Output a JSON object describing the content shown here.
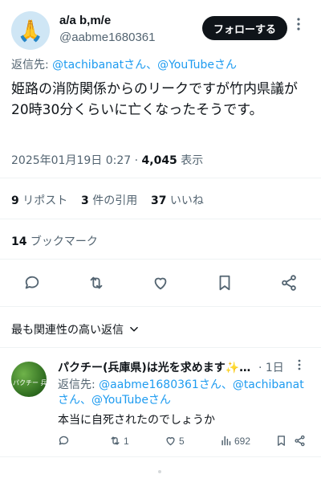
{
  "tweet": {
    "avatar_emoji": "🙏",
    "display_name": "a/a b,m/e",
    "handle": "@aabme1680361",
    "follow_label": "フォローする",
    "reply_prefix": "返信先: ",
    "reply_targets": "@tachibanatさん、@YouTubeさん",
    "text": "姫路の消防関係からのリークですが竹内県議が20時30分くらいに亡くなったそうです。",
    "timestamp": "2025年01月19日 0:27",
    "separator": " · ",
    "views_count": "4,045",
    "views_label": " 表示"
  },
  "stats": {
    "reposts_count": "9",
    "reposts_label": " リポスト",
    "quotes_count": "3",
    "quotes_label": " 件の引用",
    "likes_count": "37",
    "likes_label": " いいね",
    "bookmarks_count": "14",
    "bookmarks_label": " ブックマーク"
  },
  "sort_label": "最も関連性の高い返信",
  "reply": {
    "avatar_caption": "パクチー 兵",
    "display_name": "パクチー(兵庫県)は光を求めます✨…",
    "time": "· 1日",
    "reply_prefix": "返信先: ",
    "reply_targets": "@aabme1680361さん、@tachibanatさん、@YouTubeさん",
    "text": "本当に自死されたのでしょうか",
    "reposts": "1",
    "likes": "5",
    "views": "692"
  },
  "colors": {
    "accent": "#1d9bf0",
    "text": "#0f1419",
    "muted": "#536471",
    "divider": "#eff3f4"
  }
}
